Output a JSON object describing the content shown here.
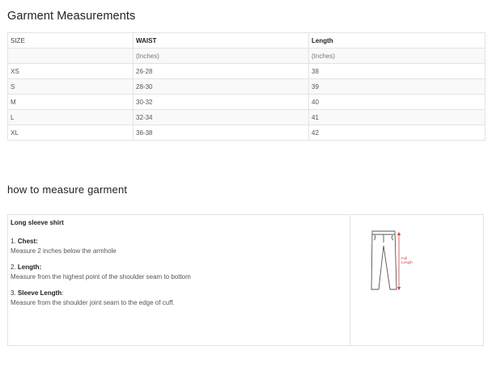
{
  "title": "Garment Measurements",
  "size_table": {
    "header": [
      "SIZE",
      "WAIST",
      "Length"
    ],
    "units": [
      "",
      "(Inches)",
      "(Inches)"
    ],
    "rows": [
      [
        "XS",
        "26-28",
        "38"
      ],
      [
        "S",
        "28-30",
        "39"
      ],
      [
        "M",
        "30-32",
        "40"
      ],
      [
        "L",
        "32-34",
        "41"
      ],
      [
        "XL",
        "36-38",
        "42"
      ]
    ]
  },
  "how_to": {
    "title": "how to measure garment",
    "heading": "Long sleeve shirt",
    "items": [
      {
        "num": "1.",
        "label": "Chest:",
        "suffix": "",
        "desc": "Measure 2 inches below the armhole"
      },
      {
        "num": "2.",
        "label": "Length:",
        "suffix": "",
        "desc": "Measure from the highest point of the shoulder seam to bottom"
      },
      {
        "num": "3.",
        "label": "Sleeve Length",
        "suffix": ":",
        "desc": "Measure from the shoulder joint seam to the edge of cuff."
      }
    ],
    "diagram": {
      "label_line1": "Full",
      "label_line2": "Length",
      "line_color": "#555555",
      "arrow_color": "#e03c3c"
    }
  }
}
